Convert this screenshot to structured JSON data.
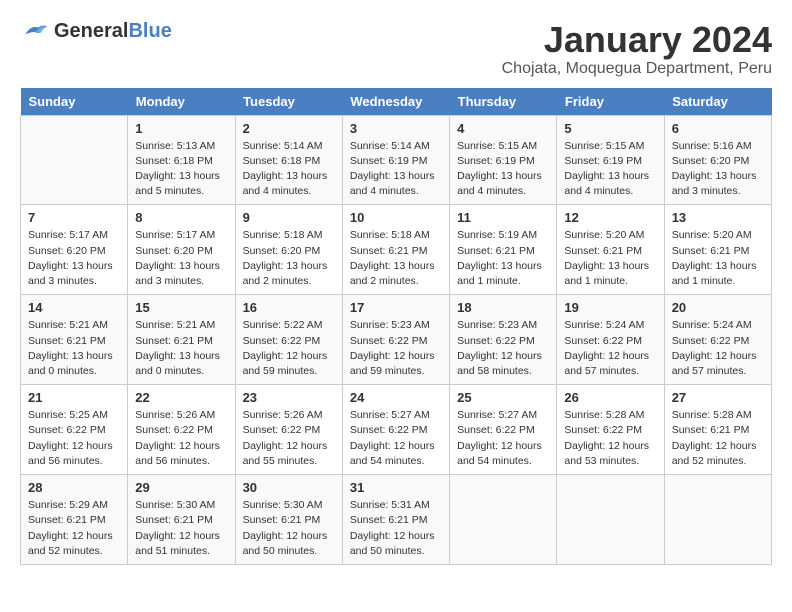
{
  "logo": {
    "general": "General",
    "blue": "Blue"
  },
  "title": "January 2024",
  "subtitle": "Chojata, Moquegua Department, Peru",
  "days_of_week": [
    "Sunday",
    "Monday",
    "Tuesday",
    "Wednesday",
    "Thursday",
    "Friday",
    "Saturday"
  ],
  "weeks": [
    [
      {
        "day": "",
        "info": ""
      },
      {
        "day": "1",
        "info": "Sunrise: 5:13 AM\nSunset: 6:18 PM\nDaylight: 13 hours\nand 5 minutes."
      },
      {
        "day": "2",
        "info": "Sunrise: 5:14 AM\nSunset: 6:18 PM\nDaylight: 13 hours\nand 4 minutes."
      },
      {
        "day": "3",
        "info": "Sunrise: 5:14 AM\nSunset: 6:19 PM\nDaylight: 13 hours\nand 4 minutes."
      },
      {
        "day": "4",
        "info": "Sunrise: 5:15 AM\nSunset: 6:19 PM\nDaylight: 13 hours\nand 4 minutes."
      },
      {
        "day": "5",
        "info": "Sunrise: 5:15 AM\nSunset: 6:19 PM\nDaylight: 13 hours\nand 4 minutes."
      },
      {
        "day": "6",
        "info": "Sunrise: 5:16 AM\nSunset: 6:20 PM\nDaylight: 13 hours\nand 3 minutes."
      }
    ],
    [
      {
        "day": "7",
        "info": "Sunrise: 5:17 AM\nSunset: 6:20 PM\nDaylight: 13 hours\nand 3 minutes."
      },
      {
        "day": "8",
        "info": "Sunrise: 5:17 AM\nSunset: 6:20 PM\nDaylight: 13 hours\nand 3 minutes."
      },
      {
        "day": "9",
        "info": "Sunrise: 5:18 AM\nSunset: 6:20 PM\nDaylight: 13 hours\nand 2 minutes."
      },
      {
        "day": "10",
        "info": "Sunrise: 5:18 AM\nSunset: 6:21 PM\nDaylight: 13 hours\nand 2 minutes."
      },
      {
        "day": "11",
        "info": "Sunrise: 5:19 AM\nSunset: 6:21 PM\nDaylight: 13 hours\nand 1 minute."
      },
      {
        "day": "12",
        "info": "Sunrise: 5:20 AM\nSunset: 6:21 PM\nDaylight: 13 hours\nand 1 minute."
      },
      {
        "day": "13",
        "info": "Sunrise: 5:20 AM\nSunset: 6:21 PM\nDaylight: 13 hours\nand 1 minute."
      }
    ],
    [
      {
        "day": "14",
        "info": "Sunrise: 5:21 AM\nSunset: 6:21 PM\nDaylight: 13 hours\nand 0 minutes."
      },
      {
        "day": "15",
        "info": "Sunrise: 5:21 AM\nSunset: 6:21 PM\nDaylight: 13 hours\nand 0 minutes."
      },
      {
        "day": "16",
        "info": "Sunrise: 5:22 AM\nSunset: 6:22 PM\nDaylight: 12 hours\nand 59 minutes."
      },
      {
        "day": "17",
        "info": "Sunrise: 5:23 AM\nSunset: 6:22 PM\nDaylight: 12 hours\nand 59 minutes."
      },
      {
        "day": "18",
        "info": "Sunrise: 5:23 AM\nSunset: 6:22 PM\nDaylight: 12 hours\nand 58 minutes."
      },
      {
        "day": "19",
        "info": "Sunrise: 5:24 AM\nSunset: 6:22 PM\nDaylight: 12 hours\nand 57 minutes."
      },
      {
        "day": "20",
        "info": "Sunrise: 5:24 AM\nSunset: 6:22 PM\nDaylight: 12 hours\nand 57 minutes."
      }
    ],
    [
      {
        "day": "21",
        "info": "Sunrise: 5:25 AM\nSunset: 6:22 PM\nDaylight: 12 hours\nand 56 minutes."
      },
      {
        "day": "22",
        "info": "Sunrise: 5:26 AM\nSunset: 6:22 PM\nDaylight: 12 hours\nand 56 minutes."
      },
      {
        "day": "23",
        "info": "Sunrise: 5:26 AM\nSunset: 6:22 PM\nDaylight: 12 hours\nand 55 minutes."
      },
      {
        "day": "24",
        "info": "Sunrise: 5:27 AM\nSunset: 6:22 PM\nDaylight: 12 hours\nand 54 minutes."
      },
      {
        "day": "25",
        "info": "Sunrise: 5:27 AM\nSunset: 6:22 PM\nDaylight: 12 hours\nand 54 minutes."
      },
      {
        "day": "26",
        "info": "Sunrise: 5:28 AM\nSunset: 6:22 PM\nDaylight: 12 hours\nand 53 minutes."
      },
      {
        "day": "27",
        "info": "Sunrise: 5:28 AM\nSunset: 6:21 PM\nDaylight: 12 hours\nand 52 minutes."
      }
    ],
    [
      {
        "day": "28",
        "info": "Sunrise: 5:29 AM\nSunset: 6:21 PM\nDaylight: 12 hours\nand 52 minutes."
      },
      {
        "day": "29",
        "info": "Sunrise: 5:30 AM\nSunset: 6:21 PM\nDaylight: 12 hours\nand 51 minutes."
      },
      {
        "day": "30",
        "info": "Sunrise: 5:30 AM\nSunset: 6:21 PM\nDaylight: 12 hours\nand 50 minutes."
      },
      {
        "day": "31",
        "info": "Sunrise: 5:31 AM\nSunset: 6:21 PM\nDaylight: 12 hours\nand 50 minutes."
      },
      {
        "day": "",
        "info": ""
      },
      {
        "day": "",
        "info": ""
      },
      {
        "day": "",
        "info": ""
      }
    ]
  ]
}
